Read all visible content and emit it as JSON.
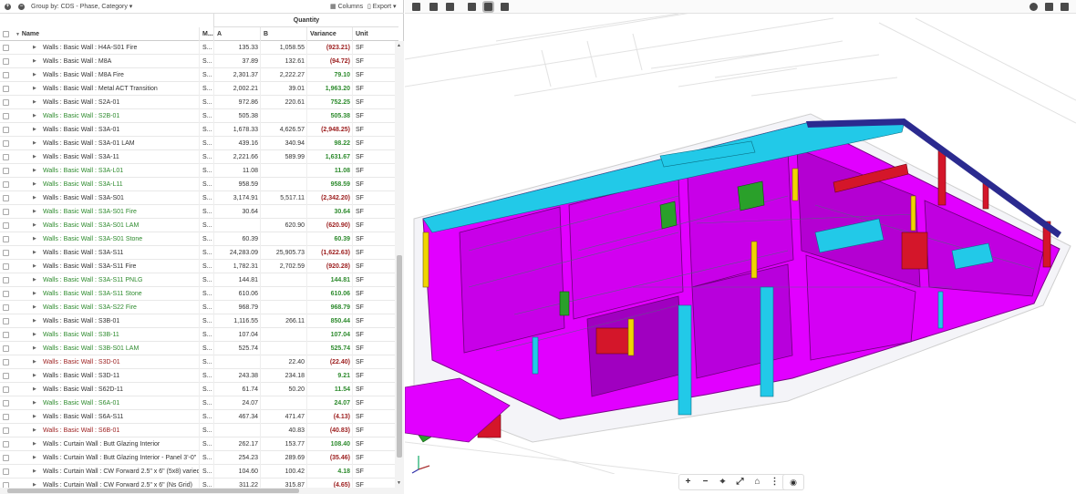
{
  "toolbar": {
    "expand_icon": "plus-circle-icon",
    "collapse_icon": "minus-circle-icon",
    "group_by_label": "Group by: CDS - Phase, Category ▾",
    "columns_label": "Columns",
    "export_label": "Export ▾"
  },
  "table": {
    "group_header": "Quantity",
    "columns": {
      "name": "Name",
      "m": "M...",
      "a": "A",
      "b": "B",
      "variance": "Variance",
      "unit": "Unit"
    },
    "rows": [
      {
        "name": "Walls : Basic Wall : H4A-S01 Fire",
        "m": "S...",
        "a": "135.33",
        "b": "1,058.55",
        "v": "(923.21)",
        "u": "SF",
        "t": "neg",
        "nc": "neu"
      },
      {
        "name": "Walls : Basic Wall : M8A",
        "m": "S...",
        "a": "37.89",
        "b": "132.61",
        "v": "(94.72)",
        "u": "SF",
        "t": "neg",
        "nc": "neu"
      },
      {
        "name": "Walls : Basic Wall : M8A Fire",
        "m": "S...",
        "a": "2,301.37",
        "b": "2,222.27",
        "v": "79.10",
        "u": "SF",
        "t": "pos",
        "nc": "neu"
      },
      {
        "name": "Walls : Basic Wall : Metal ACT Transition",
        "m": "S...",
        "a": "2,002.21",
        "b": "39.01",
        "v": "1,963.20",
        "u": "SF",
        "t": "pos",
        "nc": "neu"
      },
      {
        "name": "Walls : Basic Wall : S2A-01",
        "m": "S...",
        "a": "972.86",
        "b": "220.61",
        "v": "752.25",
        "u": "SF",
        "t": "pos",
        "nc": "neu"
      },
      {
        "name": "Walls : Basic Wall : S2B-01",
        "m": "S...",
        "a": "505.38",
        "b": "",
        "v": "505.38",
        "u": "SF",
        "t": "pos",
        "nc": "pos"
      },
      {
        "name": "Walls : Basic Wall : S3A-01",
        "m": "S...",
        "a": "1,678.33",
        "b": "4,626.57",
        "v": "(2,948.25)",
        "u": "SF",
        "t": "neg",
        "nc": "neu"
      },
      {
        "name": "Walls : Basic Wall : S3A-01 LAM",
        "m": "S...",
        "a": "439.16",
        "b": "340.94",
        "v": "98.22",
        "u": "SF",
        "t": "pos",
        "nc": "neu"
      },
      {
        "name": "Walls : Basic Wall : S3A-11",
        "m": "S...",
        "a": "2,221.66",
        "b": "589.99",
        "v": "1,631.67",
        "u": "SF",
        "t": "pos",
        "nc": "neu"
      },
      {
        "name": "Walls : Basic Wall : S3A-L01",
        "m": "S...",
        "a": "11.08",
        "b": "",
        "v": "11.08",
        "u": "SF",
        "t": "pos",
        "nc": "pos"
      },
      {
        "name": "Walls : Basic Wall : S3A-L11",
        "m": "S...",
        "a": "958.59",
        "b": "",
        "v": "958.59",
        "u": "SF",
        "t": "pos",
        "nc": "pos"
      },
      {
        "name": "Walls : Basic Wall : S3A-S01",
        "m": "S...",
        "a": "3,174.91",
        "b": "5,517.11",
        "v": "(2,342.20)",
        "u": "SF",
        "t": "neg",
        "nc": "neu"
      },
      {
        "name": "Walls : Basic Wall : S3A-S01 Fire",
        "m": "S...",
        "a": "30.64",
        "b": "",
        "v": "30.64",
        "u": "SF",
        "t": "pos",
        "nc": "pos"
      },
      {
        "name": "Walls : Basic Wall : S3A-S01 LAM",
        "m": "S...",
        "a": "",
        "b": "620.90",
        "v": "(620.90)",
        "u": "SF",
        "t": "neg",
        "nc": "pos"
      },
      {
        "name": "Walls : Basic Wall : S3A-S01 Stone",
        "m": "S...",
        "a": "60.39",
        "b": "",
        "v": "60.39",
        "u": "SF",
        "t": "pos",
        "nc": "pos"
      },
      {
        "name": "Walls : Basic Wall : S3A-S11",
        "m": "S...",
        "a": "24,283.09",
        "b": "25,905.73",
        "v": "(1,622.63)",
        "u": "SF",
        "t": "neg",
        "nc": "neu"
      },
      {
        "name": "Walls : Basic Wall : S3A-S11 Fire",
        "m": "S...",
        "a": "1,782.31",
        "b": "2,702.59",
        "v": "(920.28)",
        "u": "SF",
        "t": "neg",
        "nc": "neu"
      },
      {
        "name": "Walls : Basic Wall : S3A-S11 PNLG",
        "m": "S...",
        "a": "144.81",
        "b": "",
        "v": "144.81",
        "u": "SF",
        "t": "pos",
        "nc": "pos"
      },
      {
        "name": "Walls : Basic Wall : S3A-S11 Stone",
        "m": "S...",
        "a": "610.06",
        "b": "",
        "v": "610.06",
        "u": "SF",
        "t": "pos",
        "nc": "pos"
      },
      {
        "name": "Walls : Basic Wall : S3A-S22 Fire",
        "m": "S...",
        "a": "968.79",
        "b": "",
        "v": "968.79",
        "u": "SF",
        "t": "pos",
        "nc": "pos"
      },
      {
        "name": "Walls : Basic Wall : S3B-01",
        "m": "S...",
        "a": "1,116.55",
        "b": "266.11",
        "v": "850.44",
        "u": "SF",
        "t": "pos",
        "nc": "neu"
      },
      {
        "name": "Walls : Basic Wall : S3B-11",
        "m": "S...",
        "a": "107.04",
        "b": "",
        "v": "107.04",
        "u": "SF",
        "t": "pos",
        "nc": "pos"
      },
      {
        "name": "Walls : Basic Wall : S3B-S01 LAM",
        "m": "S...",
        "a": "525.74",
        "b": "",
        "v": "525.74",
        "u": "SF",
        "t": "pos",
        "nc": "pos"
      },
      {
        "name": "Walls : Basic Wall : S3D-01",
        "m": "S...",
        "a": "",
        "b": "22.40",
        "v": "(22.40)",
        "u": "SF",
        "t": "neg",
        "nc": "neg"
      },
      {
        "name": "Walls : Basic Wall : S3D-11",
        "m": "S...",
        "a": "243.38",
        "b": "234.18",
        "v": "9.21",
        "u": "SF",
        "t": "pos",
        "nc": "neu"
      },
      {
        "name": "Walls : Basic Wall : S62D-11",
        "m": "S...",
        "a": "61.74",
        "b": "50.20",
        "v": "11.54",
        "u": "SF",
        "t": "pos",
        "nc": "neu"
      },
      {
        "name": "Walls : Basic Wall : S6A-01",
        "m": "S...",
        "a": "24.07",
        "b": "",
        "v": "24.07",
        "u": "SF",
        "t": "pos",
        "nc": "pos"
      },
      {
        "name": "Walls : Basic Wall : S6A-S11",
        "m": "S...",
        "a": "467.34",
        "b": "471.47",
        "v": "(4.13)",
        "u": "SF",
        "t": "neg",
        "nc": "neu"
      },
      {
        "name": "Walls : Basic Wall : S6B-01",
        "m": "S...",
        "a": "",
        "b": "40.83",
        "v": "(40.83)",
        "u": "SF",
        "t": "neg",
        "nc": "neg"
      },
      {
        "name": "Walls : Curtain Wall : Butt Glazing Interior",
        "m": "S...",
        "a": "262.17",
        "b": "153.77",
        "v": "108.40",
        "u": "SF",
        "t": "pos",
        "nc": "neu"
      },
      {
        "name": "Walls : Curtain Wall : Butt Glazing Interior - Panel 3'-0\"",
        "m": "S...",
        "a": "254.23",
        "b": "289.69",
        "v": "(35.46)",
        "u": "SF",
        "t": "neg",
        "nc": "neu"
      },
      {
        "name": "Walls : Curtain Wall : CW Forward 2.5\" x 6\" (5x8) varied",
        "m": "S...",
        "a": "104.60",
        "b": "100.42",
        "v": "4.18",
        "u": "SF",
        "t": "pos",
        "nc": "neu"
      },
      {
        "name": "Walls : Curtain Wall : CW Forward 2.5\" x 6\" (Ns Grid)",
        "m": "S...",
        "a": "311.22",
        "b": "315.87",
        "v": "(4.65)",
        "u": "SF",
        "t": "neg",
        "nc": "neu"
      }
    ]
  },
  "viewer": {
    "toolbar_icons": [
      "section-box-icon",
      "layers-icon",
      "view-icon",
      "cube-icon",
      "lock-view-icon",
      "document-icon"
    ],
    "right_icons": [
      "settings-icon",
      "message-icon",
      "popout-icon"
    ],
    "bottom_icons": [
      {
        "name": "zoom-in-icon",
        "glyph": "+"
      },
      {
        "name": "zoom-out-icon",
        "glyph": "−"
      },
      {
        "name": "orbit-icon",
        "glyph": "⌖"
      },
      {
        "name": "fit-view-icon",
        "glyph": "⤢"
      },
      {
        "name": "home-icon",
        "glyph": "⌂"
      },
      {
        "name": "more-icon",
        "glyph": "⋮"
      }
    ],
    "camera_icon": "camera-icon",
    "colors": {
      "magenta": "#e100ff",
      "cyan": "#22c9e8",
      "green": "#2aa02a",
      "red": "#d4162a",
      "yellow": "#f0d400",
      "navy": "#2b2a8f"
    }
  }
}
